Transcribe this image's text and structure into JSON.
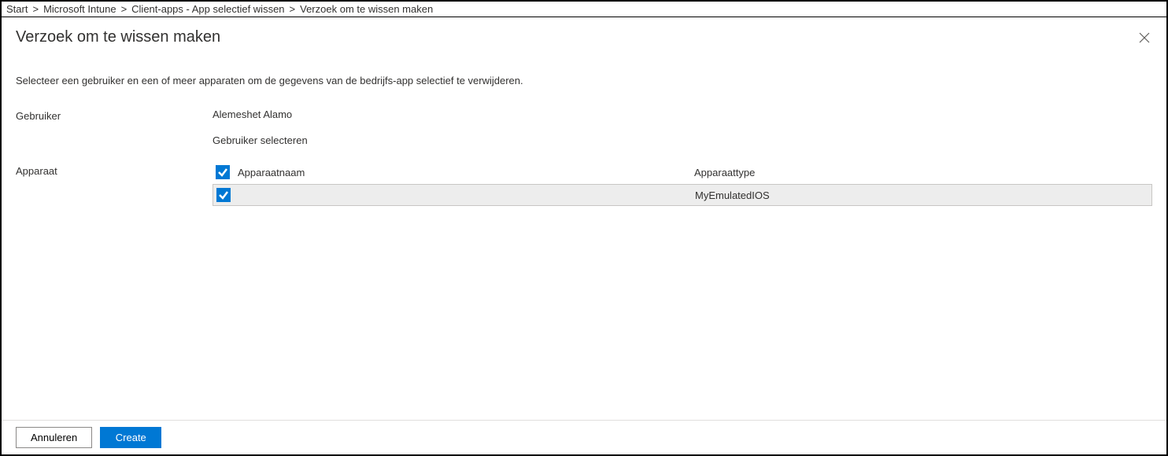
{
  "breadcrumb": {
    "items": [
      "Start",
      "Microsoft Intune",
      "Client-apps - App selectief wissen",
      "Verzoek om te wissen maken"
    ],
    "separator": "&gt;"
  },
  "page_title": "Verzoek om te wissen maken",
  "instructions": "Selecteer een gebruiker en een of meer apparaten om de gegevens van de bedrijfs-app selectief te verwijderen.",
  "labels": {
    "user": "Gebruiker",
    "device": "Apparaat"
  },
  "user": {
    "name": "Alemeshet Alamo",
    "select_link": "Gebruiker selecteren"
  },
  "device_table": {
    "columns": {
      "name": "Apparaatnaam",
      "type": "Apparaattype"
    },
    "rows": [
      {
        "name": "",
        "type": "MyEmulatedIOS",
        "checked": true
      }
    ]
  },
  "footer": {
    "cancel": "Annuleren",
    "create": "Create"
  }
}
